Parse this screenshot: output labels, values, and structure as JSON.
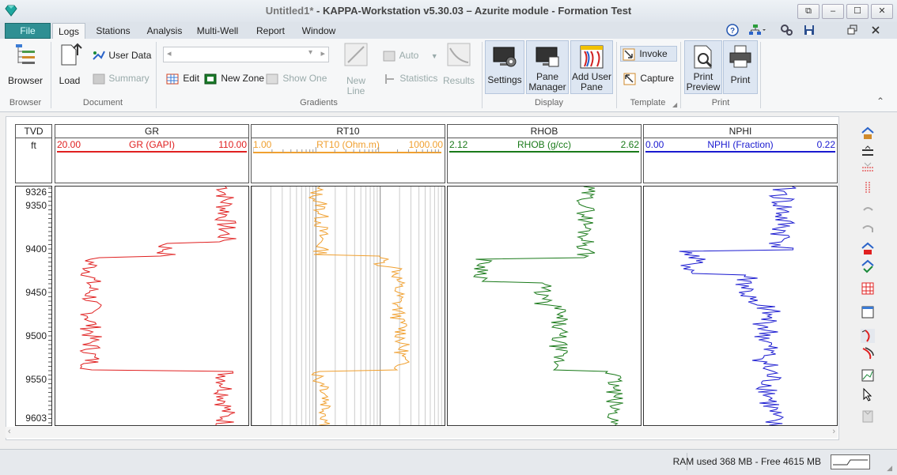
{
  "window": {
    "title_doc": "Untitled1*",
    "title_rest": " - KAPPA-Workstation v5.30.03  – Azurite module - Formation Test",
    "controls": [
      "⧉",
      "–",
      "☐",
      "✕"
    ]
  },
  "tabs": {
    "file": "File",
    "items": [
      "Logs",
      "Stations",
      "Analysis",
      "Multi-Well",
      "Report",
      "Window"
    ],
    "active": "Logs"
  },
  "ribbon": {
    "browser": {
      "button": "Browser",
      "group": "Browser"
    },
    "document": {
      "load": "Load",
      "user_data": "User Data",
      "summary": "Summary",
      "group": "Document"
    },
    "gradients": {
      "combo_value": "",
      "edit": "Edit",
      "new_zone": "New Zone",
      "show_one": "Show One",
      "new_line": "New Line",
      "auto": "Auto",
      "statistics": "Statistics",
      "results": "Results",
      "group": "Gradients"
    },
    "display": {
      "settings": "Settings",
      "pane_manager_1": "Pane",
      "pane_manager_2": "Manager",
      "add_user_pane_1": "Add User",
      "add_user_pane_2": "Pane",
      "group": "Display"
    },
    "template": {
      "invoke": "Invoke",
      "capture": "Capture",
      "group": "Template"
    },
    "print": {
      "preview_1": "Print",
      "preview_2": "Preview",
      "print": "Print",
      "group": "Print"
    }
  },
  "log": {
    "depth": {
      "name": "TVD",
      "unit": "ft",
      "labels": [
        "9326",
        "9350",
        "9400",
        "9450",
        "9500",
        "9550",
        "9603"
      ]
    },
    "tracks": [
      {
        "name": "GR",
        "min": "20.00",
        "curve": "GR (GAPI)",
        "max": "110.00",
        "color": "#e02020"
      },
      {
        "name": "RT10",
        "min": "1.00",
        "curve": "RT10 (Ohm.m)",
        "max": "1000.00",
        "color": "#f0a030"
      },
      {
        "name": "RHOB",
        "min": "2.12",
        "curve": "RHOB (g/cc)",
        "max": "2.62",
        "color": "#1a7a1a"
      },
      {
        "name": "NPHI",
        "min": "0.00",
        "curve": "NPHI (Fraction)",
        "max": "0.22",
        "color": "#1a1ad0"
      }
    ]
  },
  "status": {
    "ram": "RAM used 368 MB - Free 4615 MB"
  }
}
